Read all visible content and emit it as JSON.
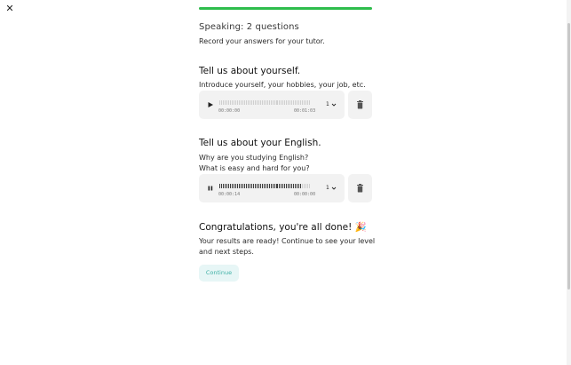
{
  "close_label": "✕",
  "progress": {
    "fraction": 1.0,
    "color": "#2ebd4c"
  },
  "header": {
    "title": "Speaking: 2 questions",
    "subtitle": "Record your answers for your tutor."
  },
  "questions": [
    {
      "title": "Tell us about yourself.",
      "prompt_lines": [
        "Introduce yourself, your hobbies, your job, etc."
      ],
      "player": {
        "state": "paused",
        "current_time": "00:00:00",
        "duration": "00:01:03",
        "speed": "1",
        "played_fraction": 0.0,
        "icon": "play-icon"
      }
    },
    {
      "title": "Tell us about your English.",
      "prompt_lines": [
        "Why are you studying English?",
        "What is easy and hard for you?"
      ],
      "player": {
        "state": "playing",
        "current_time": "00:00:14",
        "duration": "00:00:00",
        "speed": "1",
        "played_fraction": 0.9,
        "icon": "pause-icon"
      }
    }
  ],
  "done": {
    "title": "Congratulations, you're all done! 🎉",
    "body_lines": [
      "Your results are ready! Continue to see your level",
      "and next steps."
    ]
  },
  "continue_label": "Continue",
  "colors": {
    "accent": "#3fb0a6",
    "button_bg": "#e7f6f6",
    "player_bg": "#f2f2f2"
  }
}
